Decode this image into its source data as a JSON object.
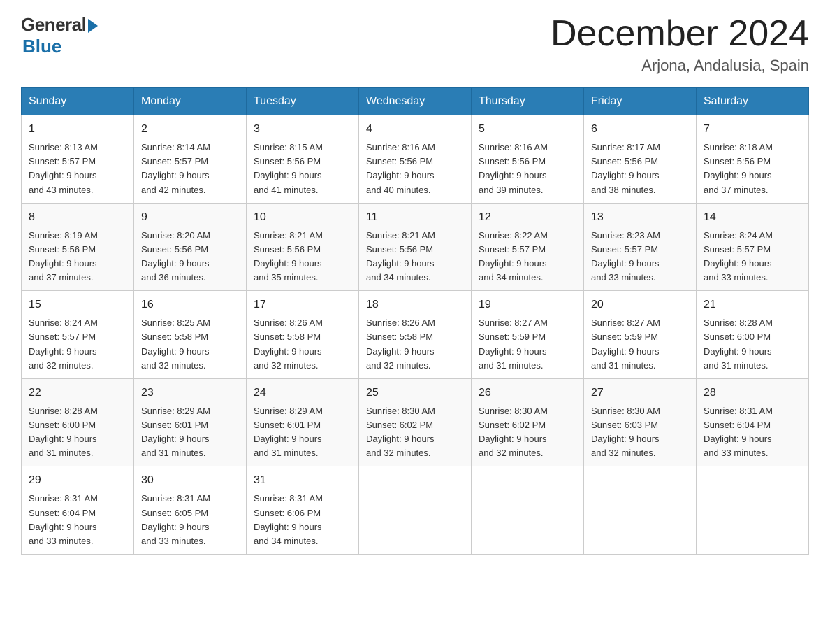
{
  "logo": {
    "general": "General",
    "blue": "Blue"
  },
  "title": {
    "month": "December 2024",
    "location": "Arjona, Andalusia, Spain"
  },
  "headers": [
    "Sunday",
    "Monday",
    "Tuesday",
    "Wednesday",
    "Thursday",
    "Friday",
    "Saturday"
  ],
  "weeks": [
    [
      {
        "day": "1",
        "sunrise": "8:13 AM",
        "sunset": "5:57 PM",
        "daylight": "9 hours and 43 minutes."
      },
      {
        "day": "2",
        "sunrise": "8:14 AM",
        "sunset": "5:57 PM",
        "daylight": "9 hours and 42 minutes."
      },
      {
        "day": "3",
        "sunrise": "8:15 AM",
        "sunset": "5:56 PM",
        "daylight": "9 hours and 41 minutes."
      },
      {
        "day": "4",
        "sunrise": "8:16 AM",
        "sunset": "5:56 PM",
        "daylight": "9 hours and 40 minutes."
      },
      {
        "day": "5",
        "sunrise": "8:16 AM",
        "sunset": "5:56 PM",
        "daylight": "9 hours and 39 minutes."
      },
      {
        "day": "6",
        "sunrise": "8:17 AM",
        "sunset": "5:56 PM",
        "daylight": "9 hours and 38 minutes."
      },
      {
        "day": "7",
        "sunrise": "8:18 AM",
        "sunset": "5:56 PM",
        "daylight": "9 hours and 37 minutes."
      }
    ],
    [
      {
        "day": "8",
        "sunrise": "8:19 AM",
        "sunset": "5:56 PM",
        "daylight": "9 hours and 37 minutes."
      },
      {
        "day": "9",
        "sunrise": "8:20 AM",
        "sunset": "5:56 PM",
        "daylight": "9 hours and 36 minutes."
      },
      {
        "day": "10",
        "sunrise": "8:21 AM",
        "sunset": "5:56 PM",
        "daylight": "9 hours and 35 minutes."
      },
      {
        "day": "11",
        "sunrise": "8:21 AM",
        "sunset": "5:56 PM",
        "daylight": "9 hours and 34 minutes."
      },
      {
        "day": "12",
        "sunrise": "8:22 AM",
        "sunset": "5:57 PM",
        "daylight": "9 hours and 34 minutes."
      },
      {
        "day": "13",
        "sunrise": "8:23 AM",
        "sunset": "5:57 PM",
        "daylight": "9 hours and 33 minutes."
      },
      {
        "day": "14",
        "sunrise": "8:24 AM",
        "sunset": "5:57 PM",
        "daylight": "9 hours and 33 minutes."
      }
    ],
    [
      {
        "day": "15",
        "sunrise": "8:24 AM",
        "sunset": "5:57 PM",
        "daylight": "9 hours and 32 minutes."
      },
      {
        "day": "16",
        "sunrise": "8:25 AM",
        "sunset": "5:58 PM",
        "daylight": "9 hours and 32 minutes."
      },
      {
        "day": "17",
        "sunrise": "8:26 AM",
        "sunset": "5:58 PM",
        "daylight": "9 hours and 32 minutes."
      },
      {
        "day": "18",
        "sunrise": "8:26 AM",
        "sunset": "5:58 PM",
        "daylight": "9 hours and 32 minutes."
      },
      {
        "day": "19",
        "sunrise": "8:27 AM",
        "sunset": "5:59 PM",
        "daylight": "9 hours and 31 minutes."
      },
      {
        "day": "20",
        "sunrise": "8:27 AM",
        "sunset": "5:59 PM",
        "daylight": "9 hours and 31 minutes."
      },
      {
        "day": "21",
        "sunrise": "8:28 AM",
        "sunset": "6:00 PM",
        "daylight": "9 hours and 31 minutes."
      }
    ],
    [
      {
        "day": "22",
        "sunrise": "8:28 AM",
        "sunset": "6:00 PM",
        "daylight": "9 hours and 31 minutes."
      },
      {
        "day": "23",
        "sunrise": "8:29 AM",
        "sunset": "6:01 PM",
        "daylight": "9 hours and 31 minutes."
      },
      {
        "day": "24",
        "sunrise": "8:29 AM",
        "sunset": "6:01 PM",
        "daylight": "9 hours and 31 minutes."
      },
      {
        "day": "25",
        "sunrise": "8:30 AM",
        "sunset": "6:02 PM",
        "daylight": "9 hours and 32 minutes."
      },
      {
        "day": "26",
        "sunrise": "8:30 AM",
        "sunset": "6:02 PM",
        "daylight": "9 hours and 32 minutes."
      },
      {
        "day": "27",
        "sunrise": "8:30 AM",
        "sunset": "6:03 PM",
        "daylight": "9 hours and 32 minutes."
      },
      {
        "day": "28",
        "sunrise": "8:31 AM",
        "sunset": "6:04 PM",
        "daylight": "9 hours and 33 minutes."
      }
    ],
    [
      {
        "day": "29",
        "sunrise": "8:31 AM",
        "sunset": "6:04 PM",
        "daylight": "9 hours and 33 minutes."
      },
      {
        "day": "30",
        "sunrise": "8:31 AM",
        "sunset": "6:05 PM",
        "daylight": "9 hours and 33 minutes."
      },
      {
        "day": "31",
        "sunrise": "8:31 AM",
        "sunset": "6:06 PM",
        "daylight": "9 hours and 34 minutes."
      },
      null,
      null,
      null,
      null
    ]
  ],
  "labels": {
    "sunrise": "Sunrise:",
    "sunset": "Sunset:",
    "daylight": "Daylight:"
  }
}
